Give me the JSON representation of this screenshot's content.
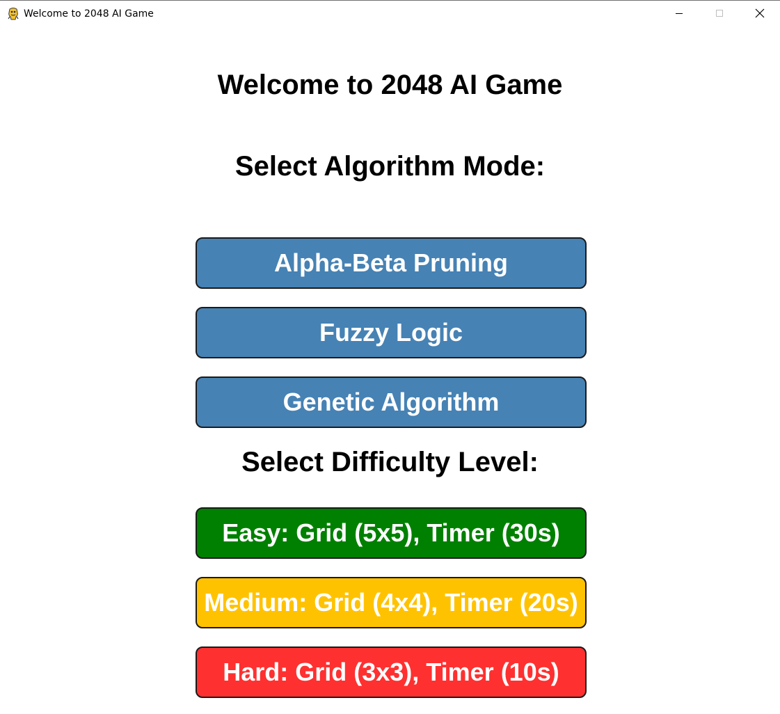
{
  "window": {
    "title": "Welcome to 2048 AI Game",
    "icon": "pygame-snake-icon",
    "controls": {
      "minimize_icon": "minimize-icon",
      "maximize_icon": "maximize-icon",
      "close_icon": "close-icon"
    }
  },
  "main": {
    "title": "Welcome to 2048 AI Game",
    "algorithm_heading": "Select Algorithm Mode:",
    "algorithms": [
      {
        "label": "Alpha-Beta Pruning"
      },
      {
        "label": "Fuzzy Logic"
      },
      {
        "label": "Genetic Algorithm"
      }
    ],
    "difficulty_heading": "Select Difficulty Level:",
    "difficulties": [
      {
        "label": "Easy: Grid (5x5), Timer (30s)"
      },
      {
        "label": "Medium: Grid (4x4), Timer (20s)"
      },
      {
        "label": "Hard: Grid (3x3), Timer (10s)"
      }
    ]
  },
  "colors": {
    "algorithm_button": "#4682b4",
    "easy_button": "#008000",
    "medium_button": "#ffc200",
    "hard_button": "#ff3030",
    "button_text": "#ffffff",
    "button_border": "#1a1a1a",
    "background": "#ffffff"
  }
}
